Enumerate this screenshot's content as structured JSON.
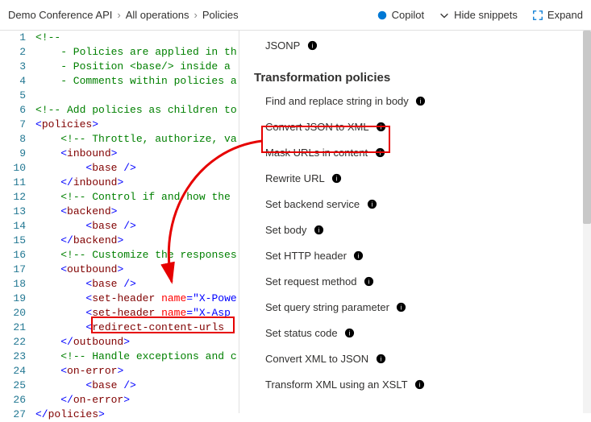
{
  "breadcrumb": {
    "a": "Demo Conference API",
    "b": "All operations",
    "c": "Policies"
  },
  "header": {
    "copilot": "Copilot",
    "hide_snippets": "Hide snippets",
    "expand": "Expand"
  },
  "editor": {
    "lines": [
      {
        "n": "1",
        "seg": [
          {
            "t": "<!--",
            "c": "c-comment"
          }
        ]
      },
      {
        "n": "2",
        "seg": [
          {
            "t": "    - Policies are applied in th",
            "c": "c-comment"
          }
        ]
      },
      {
        "n": "3",
        "seg": [
          {
            "t": "    - Position <base/> inside a ",
            "c": "c-comment"
          }
        ]
      },
      {
        "n": "4",
        "seg": [
          {
            "t": "    - Comments within policies a",
            "c": "c-comment"
          }
        ]
      },
      {
        "n": "5",
        "seg": []
      },
      {
        "n": "6",
        "seg": [
          {
            "t": "<!-- Add policies as children to",
            "c": "c-comment"
          }
        ]
      },
      {
        "n": "7",
        "seg": [
          {
            "t": "<",
            "c": "c-punct"
          },
          {
            "t": "policies",
            "c": "c-tag"
          },
          {
            "t": ">",
            "c": "c-punct"
          }
        ]
      },
      {
        "n": "8",
        "seg": [
          {
            "t": "    ",
            "c": ""
          },
          {
            "t": "<!-- Throttle, authorize, va",
            "c": "c-comment"
          }
        ]
      },
      {
        "n": "9",
        "seg": [
          {
            "t": "    ",
            "c": ""
          },
          {
            "t": "<",
            "c": "c-punct"
          },
          {
            "t": "inbound",
            "c": "c-tag"
          },
          {
            "t": ">",
            "c": "c-punct"
          }
        ]
      },
      {
        "n": "10",
        "seg": [
          {
            "t": "        ",
            "c": ""
          },
          {
            "t": "<",
            "c": "c-punct"
          },
          {
            "t": "base",
            "c": "c-tag"
          },
          {
            "t": " />",
            "c": "c-punct"
          }
        ]
      },
      {
        "n": "11",
        "seg": [
          {
            "t": "    ",
            "c": ""
          },
          {
            "t": "</",
            "c": "c-punct"
          },
          {
            "t": "inbound",
            "c": "c-tag"
          },
          {
            "t": ">",
            "c": "c-punct"
          }
        ]
      },
      {
        "n": "12",
        "seg": [
          {
            "t": "    ",
            "c": ""
          },
          {
            "t": "<!-- Control if and how the ",
            "c": "c-comment"
          }
        ]
      },
      {
        "n": "13",
        "seg": [
          {
            "t": "    ",
            "c": ""
          },
          {
            "t": "<",
            "c": "c-punct"
          },
          {
            "t": "backend",
            "c": "c-tag"
          },
          {
            "t": ">",
            "c": "c-punct"
          }
        ]
      },
      {
        "n": "14",
        "seg": [
          {
            "t": "        ",
            "c": ""
          },
          {
            "t": "<",
            "c": "c-punct"
          },
          {
            "t": "base",
            "c": "c-tag"
          },
          {
            "t": " />",
            "c": "c-punct"
          }
        ]
      },
      {
        "n": "15",
        "seg": [
          {
            "t": "    ",
            "c": ""
          },
          {
            "t": "</",
            "c": "c-punct"
          },
          {
            "t": "backend",
            "c": "c-tag"
          },
          {
            "t": ">",
            "c": "c-punct"
          }
        ]
      },
      {
        "n": "16",
        "seg": [
          {
            "t": "    ",
            "c": ""
          },
          {
            "t": "<!-- Customize the responses",
            "c": "c-comment"
          }
        ]
      },
      {
        "n": "17",
        "seg": [
          {
            "t": "    ",
            "c": ""
          },
          {
            "t": "<",
            "c": "c-punct"
          },
          {
            "t": "outbound",
            "c": "c-tag"
          },
          {
            "t": ">",
            "c": "c-punct"
          }
        ]
      },
      {
        "n": "18",
        "seg": [
          {
            "t": "        ",
            "c": ""
          },
          {
            "t": "<",
            "c": "c-punct"
          },
          {
            "t": "base",
            "c": "c-tag"
          },
          {
            "t": " />",
            "c": "c-punct"
          }
        ]
      },
      {
        "n": "19",
        "seg": [
          {
            "t": "        ",
            "c": ""
          },
          {
            "t": "<",
            "c": "c-punct"
          },
          {
            "t": "set-header",
            "c": "c-tag"
          },
          {
            "t": " ",
            "c": ""
          },
          {
            "t": "name",
            "c": "c-attr"
          },
          {
            "t": "=\"X-Powe",
            "c": "c-punct"
          }
        ]
      },
      {
        "n": "20",
        "seg": [
          {
            "t": "        ",
            "c": ""
          },
          {
            "t": "<",
            "c": "c-punct"
          },
          {
            "t": "set-header",
            "c": "c-tag"
          },
          {
            "t": " ",
            "c": ""
          },
          {
            "t": "name",
            "c": "c-attr"
          },
          {
            "t": "=\"X-Asp",
            "c": "c-punct"
          }
        ]
      },
      {
        "n": "21",
        "seg": [
          {
            "t": "        ",
            "c": ""
          },
          {
            "t": "<",
            "c": "c-punct"
          },
          {
            "t": "redirect-content-urls",
            "c": "c-tag"
          },
          {
            "t": " ",
            "c": ""
          }
        ]
      },
      {
        "n": "22",
        "seg": [
          {
            "t": "    ",
            "c": ""
          },
          {
            "t": "</",
            "c": "c-punct"
          },
          {
            "t": "outbound",
            "c": "c-tag"
          },
          {
            "t": ">",
            "c": "c-punct"
          }
        ]
      },
      {
        "n": "23",
        "seg": [
          {
            "t": "    ",
            "c": ""
          },
          {
            "t": "<!-- Handle exceptions and c",
            "c": "c-comment"
          }
        ]
      },
      {
        "n": "24",
        "seg": [
          {
            "t": "    ",
            "c": ""
          },
          {
            "t": "<",
            "c": "c-punct"
          },
          {
            "t": "on-error",
            "c": "c-tag"
          },
          {
            "t": ">",
            "c": "c-punct"
          }
        ]
      },
      {
        "n": "25",
        "seg": [
          {
            "t": "        ",
            "c": ""
          },
          {
            "t": "<",
            "c": "c-punct"
          },
          {
            "t": "base",
            "c": "c-tag"
          },
          {
            "t": " />",
            "c": "c-punct"
          }
        ]
      },
      {
        "n": "26",
        "seg": [
          {
            "t": "    ",
            "c": ""
          },
          {
            "t": "</",
            "c": "c-punct"
          },
          {
            "t": "on-error",
            "c": "c-tag"
          },
          {
            "t": ">",
            "c": "c-punct"
          }
        ]
      },
      {
        "n": "27",
        "seg": [
          {
            "t": "</",
            "c": "c-punct"
          },
          {
            "t": "policies",
            "c": "c-tag"
          },
          {
            "t": ">",
            "c": "c-punct"
          }
        ]
      }
    ]
  },
  "panel": {
    "pill": "JSONP",
    "section": "Transformation policies",
    "items": [
      "Find and replace string in body",
      "Convert JSON to XML",
      "Mask URLs in content",
      "Rewrite URL",
      "Set backend service",
      "Set body",
      "Set HTTP header",
      "Set request method",
      "Set query string parameter",
      "Set status code",
      "Convert XML to JSON",
      "Transform XML using an XSLT"
    ]
  }
}
